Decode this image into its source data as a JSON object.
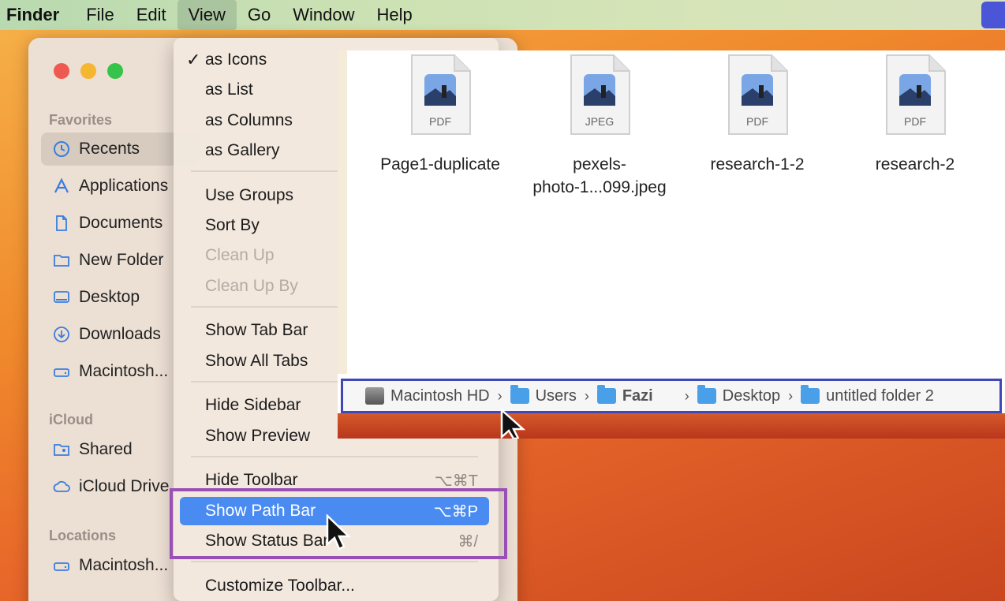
{
  "menubar": {
    "items": [
      {
        "label": "Finder"
      },
      {
        "label": "File"
      },
      {
        "label": "Edit"
      },
      {
        "label": "View"
      },
      {
        "label": "Go"
      },
      {
        "label": "Window"
      },
      {
        "label": "Help"
      }
    ]
  },
  "sidebar": {
    "favorites_header": "Favorites",
    "favorites": [
      {
        "label": "Recents",
        "icon": "clock-icon"
      },
      {
        "label": "Applications",
        "icon": "applications-icon"
      },
      {
        "label": "Documents",
        "icon": "document-icon"
      },
      {
        "label": "New Folder",
        "icon": "folder-icon"
      },
      {
        "label": "Desktop",
        "icon": "desktop-icon"
      },
      {
        "label": "Downloads",
        "icon": "download-icon"
      },
      {
        "label": "Macintosh...",
        "icon": "hard-drive-icon"
      }
    ],
    "icloud_header": "iCloud",
    "icloud": [
      {
        "label": "Shared",
        "icon": "shared-folder-icon"
      },
      {
        "label": "iCloud Drive",
        "icon": "cloud-icon"
      }
    ],
    "locations_header": "Locations",
    "locations": [
      {
        "label": "Macintosh...",
        "icon": "hard-drive-icon"
      }
    ]
  },
  "view_menu": {
    "items": [
      {
        "label": "as Icons",
        "checked": true,
        "check": "✓"
      },
      {
        "label": "as List"
      },
      {
        "label": "as Columns"
      },
      {
        "label": "as Gallery"
      },
      {
        "label": "Use Groups"
      },
      {
        "label": "Sort By"
      },
      {
        "label": "Clean Up",
        "disabled": true
      },
      {
        "label": "Clean Up By",
        "disabled": true
      },
      {
        "label": "Show Tab Bar"
      },
      {
        "label": "Show All Tabs"
      },
      {
        "label": "Hide Sidebar"
      },
      {
        "label": "Show Preview"
      },
      {
        "label": "Hide Toolbar",
        "shortcut": "⌥⌘T"
      },
      {
        "label": "Show Path Bar",
        "shortcut": "⌥⌘P",
        "highlighted": true
      },
      {
        "label": "Show Status Bar",
        "shortcut": "⌘/"
      },
      {
        "label": "Customize Toolbar..."
      }
    ]
  },
  "files": [
    {
      "name": "Page1-duplicate",
      "type": "PDF"
    },
    {
      "name": "pexels-\nphoto-1...099.jpeg",
      "type": "JPEG"
    },
    {
      "name": "research-1-2",
      "type": "PDF"
    },
    {
      "name": "research-2",
      "type": "PDF"
    }
  ],
  "path_bar": {
    "segments": [
      {
        "label": "Macintosh HD",
        "icon": "hard-drive-icon"
      },
      {
        "label": "Users",
        "icon": "folder-icon"
      },
      {
        "label": "Fazi",
        "icon": "home-folder-icon"
      },
      {
        "label": "Desktop",
        "icon": "folder-icon"
      },
      {
        "label": "untitled folder 2",
        "icon": "folder-icon"
      }
    ],
    "separator": "›"
  },
  "colors": {
    "menu_highlight": "#4a8bf2",
    "annotation_purple": "#9a4fb6",
    "annotation_blue": "#4048b8"
  }
}
